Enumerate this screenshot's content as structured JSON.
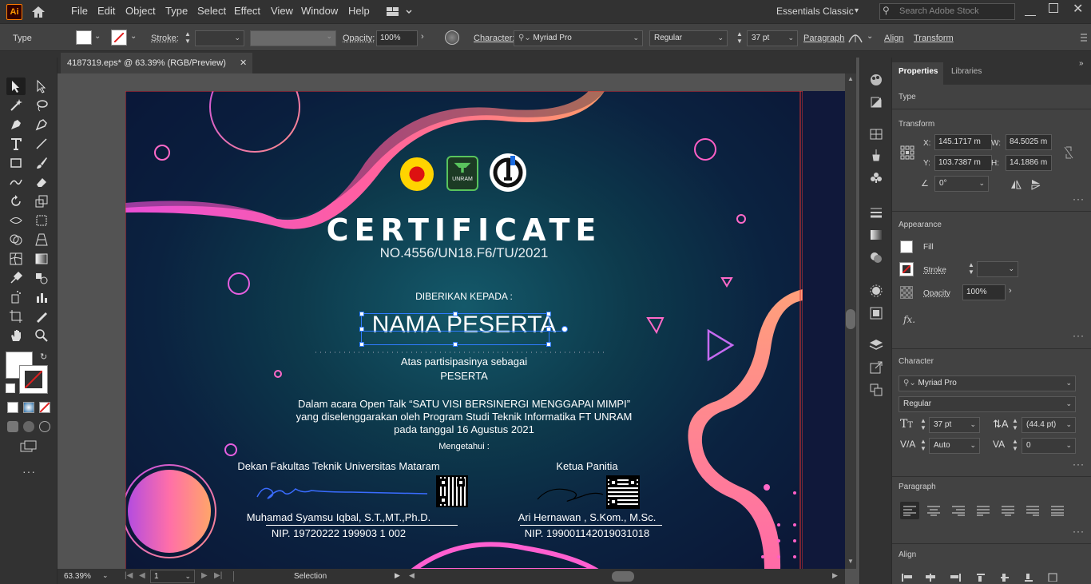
{
  "menubar": {
    "app_badge": "Ai",
    "items": [
      "File",
      "Edit",
      "Object",
      "Type",
      "Select",
      "Effect",
      "View",
      "Window",
      "Help"
    ],
    "workspace": "Essentials Classic",
    "search_placeholder": "Search Adobe Stock"
  },
  "control": {
    "tool_label": "Type",
    "stroke_label": "Stroke:",
    "opacity_label": "Opacity:",
    "opacity_value": "100%",
    "character_label": "Character:",
    "font_family": "Myriad Pro",
    "font_style": "Regular",
    "font_size": "37 pt",
    "paragraph_label": "Paragraph",
    "align_label": "Align",
    "transform_label": "Transform"
  },
  "document": {
    "tab_title": "4187319.eps* @ 63.39% (RGB/Preview)",
    "zoom": "63.39%",
    "artboard": "1",
    "status": "Selection"
  },
  "certificate": {
    "logo2_text": "UNRAM",
    "title": "CERTIFICATE",
    "number": "NO.4556/UN18.F6/TU/2021",
    "given_to": "DIBERIKAN KEPADA :",
    "name": "NAMA PESERTA",
    "role_line1": "Atas partisipasinya sebagai",
    "role_line2": "PESERTA",
    "event_line1": "Dalam acara Open Talk “SATU VISI BERSINERGI MENGGAPAI MIMPI”",
    "event_line2": "yang diselenggarakan oleh Program Studi Teknik Informatika FT UNRAM",
    "event_line3": "pada tanggal 16 Agustus 2021",
    "acknowledged": "Mengetahui :",
    "sig1_title": "Dekan Fakultas Teknik Universitas Mataram",
    "sig1_name": "Muhamad Syamsu Iqbal, S.T.,MT.,Ph.D.",
    "sig1_nip": "NIP. 19720222 199903 1 002",
    "sig2_title": "Ketua Panitia",
    "sig2_name": "Ari Hernawan , S.Kom., M.Sc.",
    "sig2_nip": "NIP. 199001142019031018"
  },
  "panel": {
    "tab_properties": "Properties",
    "tab_libraries": "Libraries",
    "type_label": "Type",
    "transform_label": "Transform",
    "x_label": "X:",
    "x_value": "145.1717 m",
    "y_label": "Y:",
    "y_value": "103.7387 m",
    "w_label": "W:",
    "w_value": "84.5025 m",
    "h_label": "H:",
    "h_value": "14.1886 m",
    "angle_value": "0°",
    "appearance_label": "Appearance",
    "fill_label": "Fill",
    "stroke_label": "Stroke",
    "opacity_label": "Opacity",
    "opacity_value": "100%",
    "fx_label": "fx.",
    "character_label": "Character",
    "font_family": "Myriad Pro",
    "font_style": "Regular",
    "font_size": "37 pt",
    "leading": "(44.4 pt)",
    "kerning": "Auto",
    "tracking": "0",
    "paragraph_label": "Paragraph",
    "align_label": "Align"
  },
  "colors": {
    "accent_pink": "#ff5fb0",
    "accent_orange": "#ff9a6a",
    "selection_blue": "#2f7bff",
    "bg_dark": "#0b2240"
  }
}
